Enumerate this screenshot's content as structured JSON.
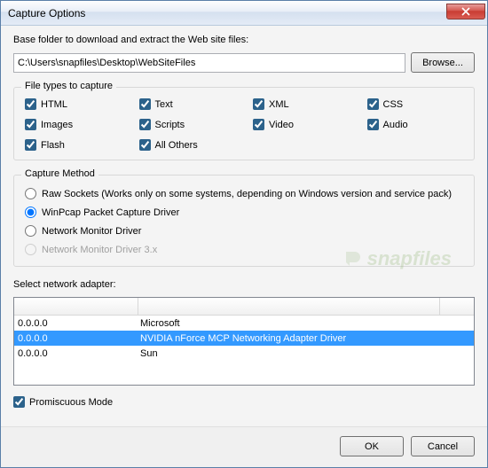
{
  "window": {
    "title": "Capture Options"
  },
  "baseFolder": {
    "label": "Base folder to download and extract the Web site files:",
    "value": "C:\\Users\\snapfiles\\Desktop\\WebSiteFiles",
    "browseLabel": "Browse..."
  },
  "fileTypes": {
    "groupTitle": "File types to capture",
    "items": [
      {
        "label": "HTML",
        "checked": true
      },
      {
        "label": "Text",
        "checked": true
      },
      {
        "label": "XML",
        "checked": true
      },
      {
        "label": "CSS",
        "checked": true
      },
      {
        "label": "Images",
        "checked": true
      },
      {
        "label": "Scripts",
        "checked": true
      },
      {
        "label": "Video",
        "checked": true
      },
      {
        "label": "Audio",
        "checked": true
      },
      {
        "label": "Flash",
        "checked": true
      },
      {
        "label": "All Others",
        "checked": true
      }
    ]
  },
  "captureMethod": {
    "groupTitle": "Capture Method",
    "options": [
      {
        "label": "Raw Sockets  (Works only on some systems, depending on Windows version and service pack)",
        "selected": false,
        "disabled": false
      },
      {
        "label": "WinPcap Packet Capture Driver",
        "selected": true,
        "disabled": false
      },
      {
        "label": "Network Monitor Driver",
        "selected": false,
        "disabled": false
      },
      {
        "label": "Network Monitor Driver 3.x",
        "selected": false,
        "disabled": true
      }
    ]
  },
  "adapters": {
    "label": "Select network adapter:",
    "rows": [
      {
        "ip": "0.0.0.0",
        "name": "Microsoft",
        "selected": false
      },
      {
        "ip": "0.0.0.0",
        "name": "NVIDIA nForce MCP Networking Adapter Driver",
        "selected": true
      },
      {
        "ip": "0.0.0.0",
        "name": "Sun",
        "selected": false
      }
    ]
  },
  "promiscuous": {
    "label": "Promiscuous Mode",
    "checked": true
  },
  "buttons": {
    "ok": "OK",
    "cancel": "Cancel"
  },
  "watermark": "snapfiles"
}
